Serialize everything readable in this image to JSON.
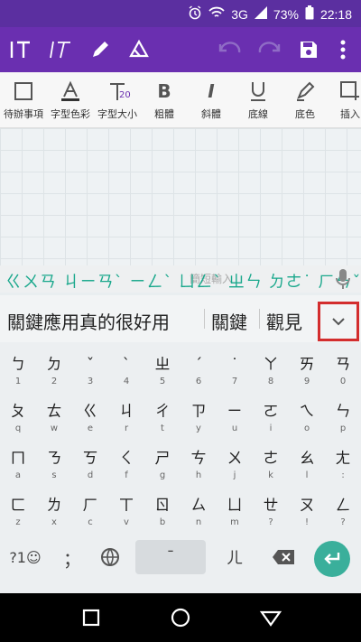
{
  "status": {
    "battery": "73%",
    "time": "22:18",
    "network": "3G"
  },
  "toolbar": {
    "buttons": [
      {
        "label": "待辦事項",
        "icon": "checkbox-icon"
      },
      {
        "label": "字型色彩",
        "icon": "font-color-icon"
      },
      {
        "label": "字型大小",
        "icon": "font-size-icon",
        "badge": "20"
      },
      {
        "label": "粗體",
        "icon": "bold-icon"
      },
      {
        "label": "斜體",
        "icon": "italic-icon"
      },
      {
        "label": "底線",
        "icon": "underline-icon"
      },
      {
        "label": "底色",
        "icon": "highlighter-icon"
      },
      {
        "label": "插入",
        "icon": "insert-icon"
      }
    ]
  },
  "input": {
    "zhuyin_hint": "ㄍㄨㄢ ㄐㄧㄢˋ ㄧㄥˋ ㄩㄥˋ ㄓㄣ ㄉㄜ˙ ㄏㄣˇ ㄏㄠˇ ㄩㄥˋ",
    "ghost": "簡短輸入"
  },
  "candidates": [
    "關鍵應用真的很好用",
    "關鍵",
    "觀見"
  ],
  "keyboard": {
    "rows": [
      [
        [
          "ㄅ",
          "1"
        ],
        [
          "ㄉ",
          "2"
        ],
        [
          "ˇ",
          "3"
        ],
        [
          "ˋ",
          "4"
        ],
        [
          "ㄓ",
          "5"
        ],
        [
          "ˊ",
          "6"
        ],
        [
          "˙",
          "7"
        ],
        [
          "ㄚ",
          "8"
        ],
        [
          "ㄞ",
          "9"
        ],
        [
          "ㄢ",
          "0"
        ]
      ],
      [
        [
          "ㄆ",
          "q"
        ],
        [
          "ㄊ",
          "w"
        ],
        [
          "ㄍ",
          "e"
        ],
        [
          "ㄐ",
          "r"
        ],
        [
          "ㄔ",
          "t"
        ],
        [
          "ㄗ",
          "y"
        ],
        [
          "ㄧ",
          "u"
        ],
        [
          "ㄛ",
          "i"
        ],
        [
          "ㄟ",
          "o"
        ],
        [
          "ㄣ",
          "p"
        ]
      ],
      [
        [
          "ㄇ",
          "a"
        ],
        [
          "ㄋ",
          "s"
        ],
        [
          "ㄎ",
          "d"
        ],
        [
          "ㄑ",
          "f"
        ],
        [
          "ㄕ",
          "g"
        ],
        [
          "ㄘ",
          "h"
        ],
        [
          "ㄨ",
          "j"
        ],
        [
          "ㄜ",
          "k"
        ],
        [
          "ㄠ",
          "l"
        ],
        [
          "ㄤ",
          ":"
        ]
      ],
      [
        [
          "ㄈ",
          "z"
        ],
        [
          "ㄌ",
          "x"
        ],
        [
          "ㄏ",
          "c"
        ],
        [
          "ㄒ",
          "v"
        ],
        [
          "ㄖ",
          "b"
        ],
        [
          "ㄙ",
          "n"
        ],
        [
          "ㄩ",
          "m"
        ],
        [
          "ㄝ",
          "?"
        ],
        [
          "ㄡ",
          "!"
        ],
        [
          "ㄥ",
          "?"
        ]
      ]
    ],
    "bottom": {
      "symbols": "?1☺",
      "punct": "；",
      "space": "ˉ",
      "er": "ㄦ"
    }
  },
  "colors": {
    "accent": "#6a2fb0",
    "enter": "#3aaf9b",
    "highlight": "#d32d2d"
  }
}
